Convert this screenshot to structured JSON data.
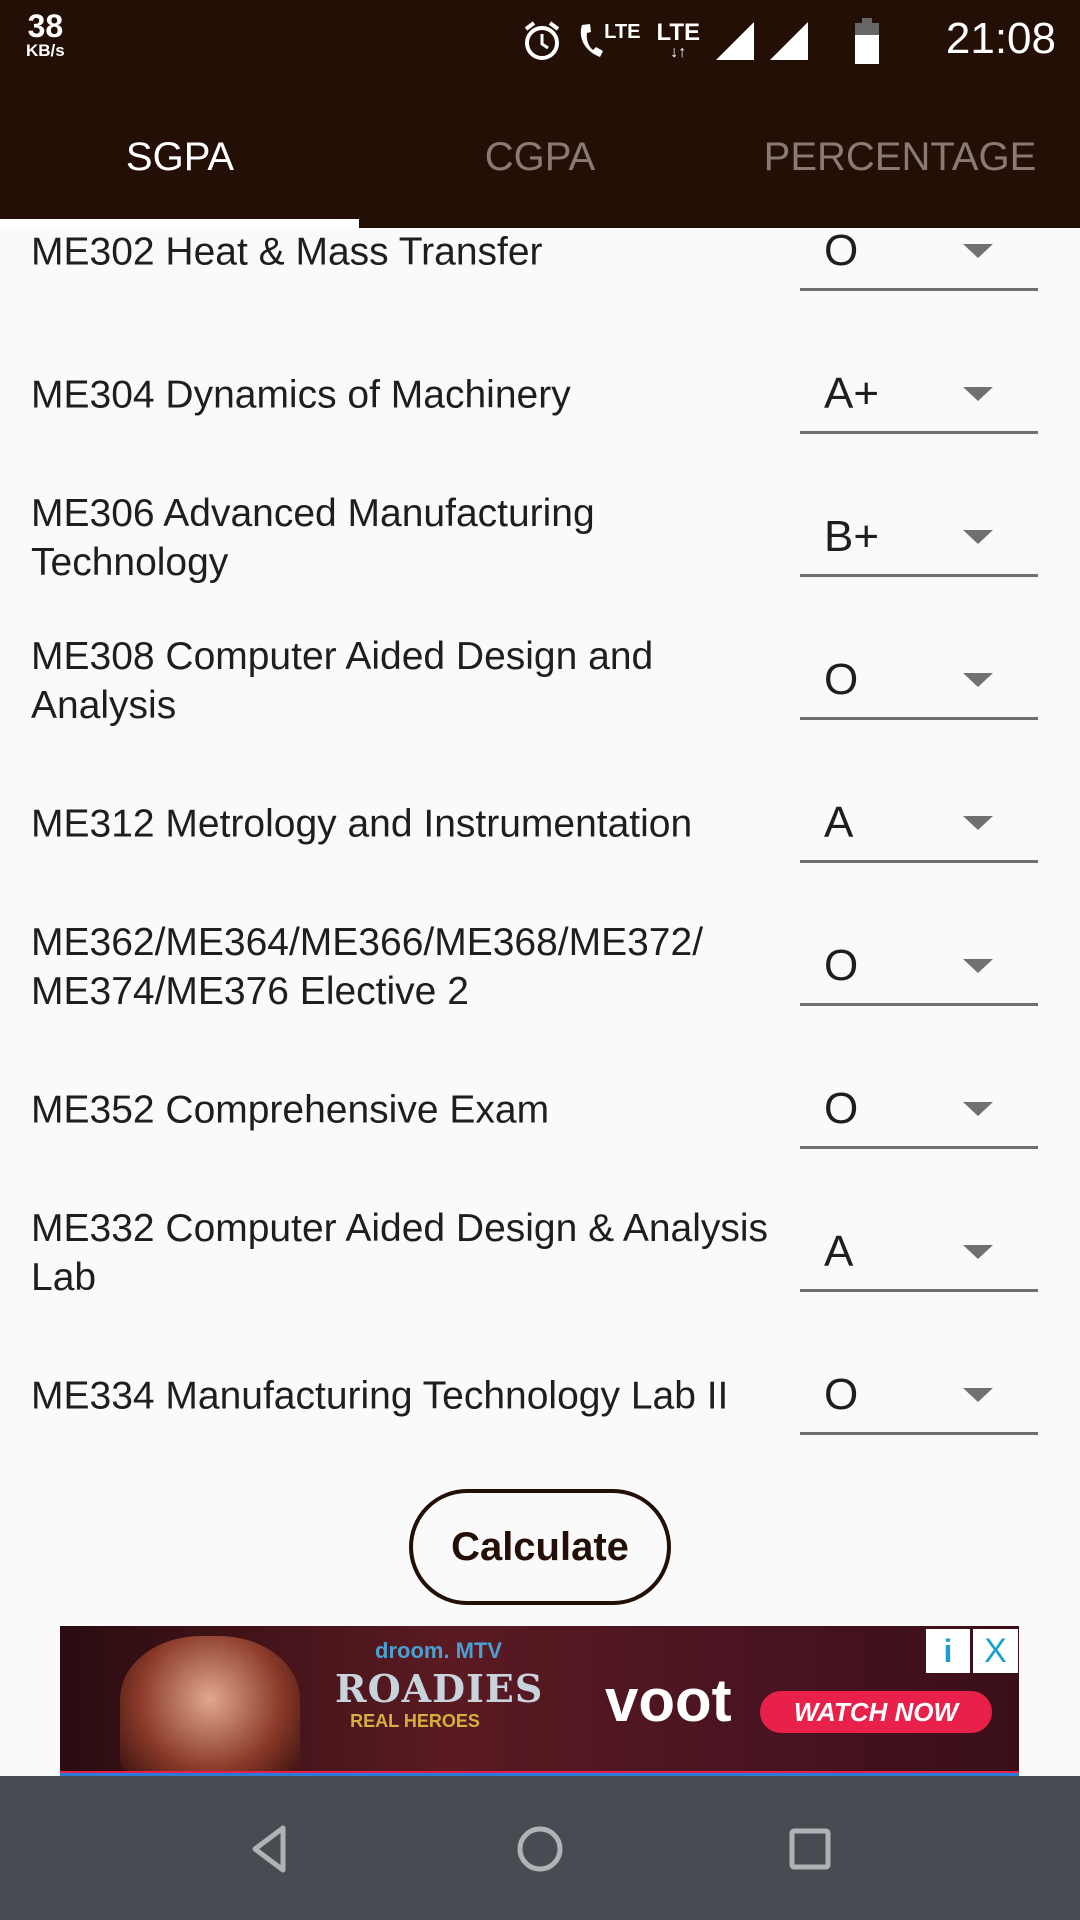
{
  "status_bar": {
    "speed_value": "38",
    "speed_unit": "KB/s",
    "time": "21:08",
    "icons": [
      "alarm-icon",
      "volte-call-icon",
      "lte-data-icon",
      "signal-icon",
      "signal-icon",
      "battery-icon"
    ],
    "lte1": "LTE",
    "lte2": "LTE"
  },
  "tabs": [
    {
      "label": "SGPA",
      "active": true
    },
    {
      "label": "CGPA",
      "active": false
    },
    {
      "label": "PERCENTAGE",
      "active": false
    }
  ],
  "courses": [
    {
      "name": "ME302  Heat & Mass Transfer",
      "grade": "O"
    },
    {
      "name": "ME304  Dynamics of Machinery",
      "grade": "A+"
    },
    {
      "name": "ME306  Advanced Manufacturing Technology",
      "grade": "B+"
    },
    {
      "name": "ME308  Computer Aided Design and Analysis",
      "grade": "O"
    },
    {
      "name": "ME312  Metrology and Instrumentation",
      "grade": "A"
    },
    {
      "name": "ME362/ME364/ME366/ME368/ME372/ ME374/ME376  Elective 2",
      "grade": "O"
    },
    {
      "name": "ME352  Comprehensive Exam",
      "grade": "O"
    },
    {
      "name": "ME332  Computer Aided Design & Analysis Lab",
      "grade": "A"
    },
    {
      "name": "ME334  Manufacturing Technology Lab II",
      "grade": "O"
    }
  ],
  "calculate_label": "Calculate",
  "ad": {
    "brand": "droom. MTV",
    "title": "ROADIES",
    "subtitle": "REAL HEROES",
    "voot": "voot",
    "cta": "WATCH NOW",
    "info": "i",
    "close": "X"
  },
  "colors": {
    "header": "#230f05",
    "nav": "#464c51",
    "cta": "#e8204a"
  }
}
